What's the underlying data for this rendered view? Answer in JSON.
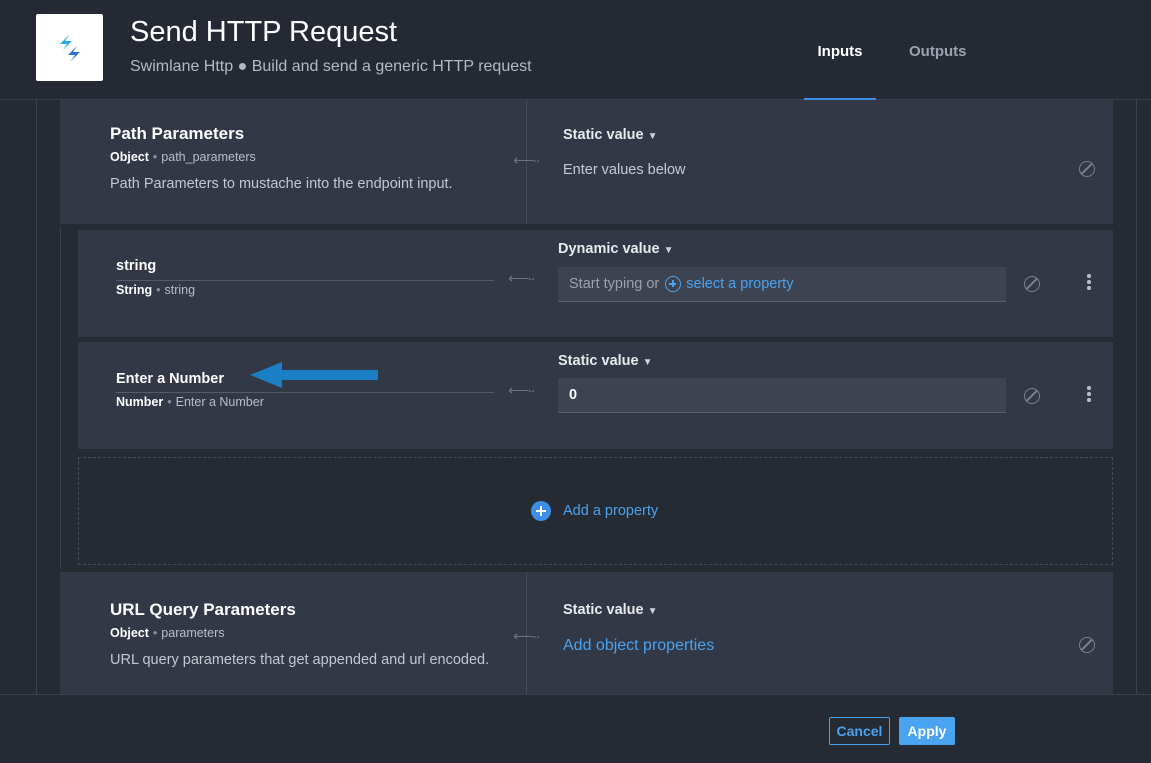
{
  "header": {
    "title": "Send HTTP Request",
    "subtitle": "Swimlane Http ● Build and send a generic HTTP request",
    "tabs": [
      {
        "label": "Inputs",
        "active": true
      },
      {
        "label": "Outputs",
        "active": false
      }
    ]
  },
  "path_params": {
    "title": "Path Parameters",
    "type": "Object",
    "key": "path_parameters",
    "description": "Path Parameters to mustache into the endpoint input.",
    "mode": "Static value",
    "value_hint": "Enter values below"
  },
  "string_field": {
    "name": "string",
    "type": "String",
    "key": "string",
    "mode": "Dynamic value",
    "placeholder": "Start typing or",
    "select_link": "select a property"
  },
  "number_field": {
    "name": "Enter a Number",
    "type": "Number",
    "key": "Enter a Number",
    "mode": "Static value",
    "value": "0"
  },
  "add_property": {
    "label": "Add a property"
  },
  "url_params": {
    "title": "URL Query Parameters",
    "type": "Object",
    "key": "parameters",
    "description": "URL query parameters that get appended and url encoded.",
    "mode": "Static value",
    "add_link": "Add object properties"
  },
  "footer": {
    "cancel": "Cancel",
    "apply": "Apply"
  },
  "colors": {
    "accent": "#4aa3f0",
    "callout_arrow": "#1a7fc4",
    "background": "#262a33",
    "card": "#333846"
  }
}
